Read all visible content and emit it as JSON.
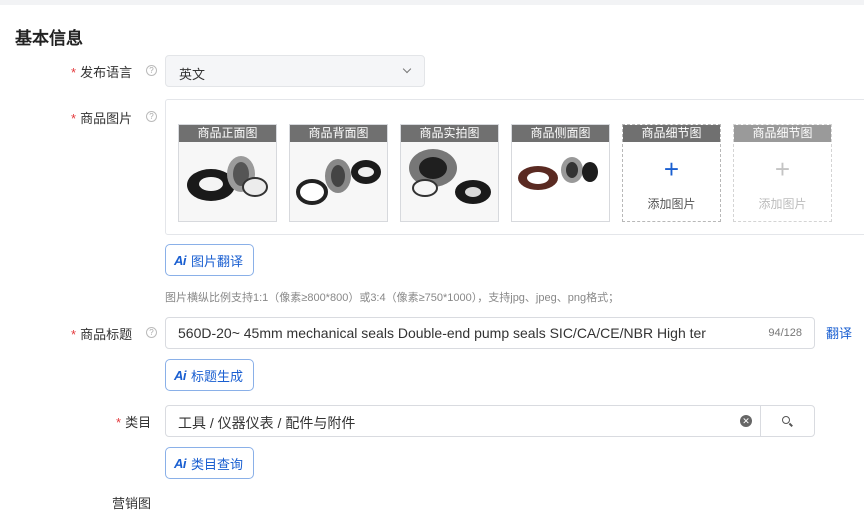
{
  "section": {
    "title": "基本信息"
  },
  "form": {
    "language": {
      "label": "发布语言",
      "value": "英文"
    },
    "images": {
      "label": "商品图片",
      "slots": [
        {
          "caption": "商品正面图"
        },
        {
          "caption": "商品背面图"
        },
        {
          "caption": "商品实拍图"
        },
        {
          "caption": "商品侧面图"
        },
        {
          "caption": "商品细节图",
          "add_label": "添加图片"
        },
        {
          "caption": "商品细节图",
          "add_label": "添加图片"
        }
      ],
      "translate_button": "图片翻译",
      "hint": "图片横纵比例支持1:1（像素≥800*800）或3:4（像素≥750*1000），支持jpg、jpeg、png格式；"
    },
    "title": {
      "label": "商品标题",
      "value": "560D-20~ 45mm mechanical seals Double-end pump seals SIC/CA/CE/NBR High ter",
      "counter": "94/128",
      "translate_link": "翻译",
      "generate_button": "标题生成"
    },
    "category": {
      "label": "类目",
      "value": "工具 / 仪器仪表 / 配件与附件",
      "query_button": "类目查询"
    },
    "next_label_partial": "营销图"
  },
  "colors": {
    "accent": "#1a5fd1",
    "required": "#e4393c"
  }
}
